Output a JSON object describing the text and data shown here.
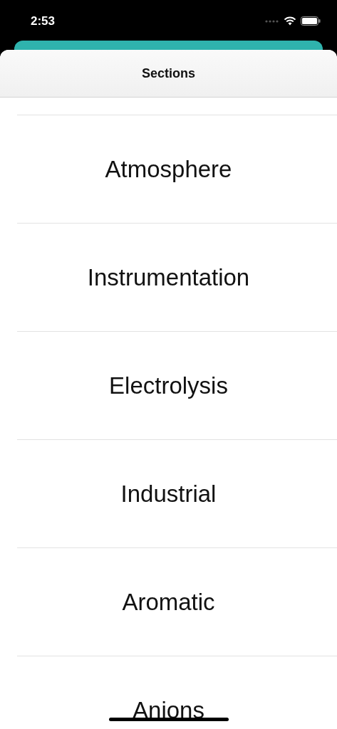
{
  "status_bar": {
    "time": "2:53"
  },
  "header": {
    "title": "Sections"
  },
  "sections": [
    {
      "label": "Atmosphere"
    },
    {
      "label": "Instrumentation"
    },
    {
      "label": "Electrolysis"
    },
    {
      "label": "Industrial"
    },
    {
      "label": "Aromatic"
    },
    {
      "label": "Anions"
    }
  ]
}
